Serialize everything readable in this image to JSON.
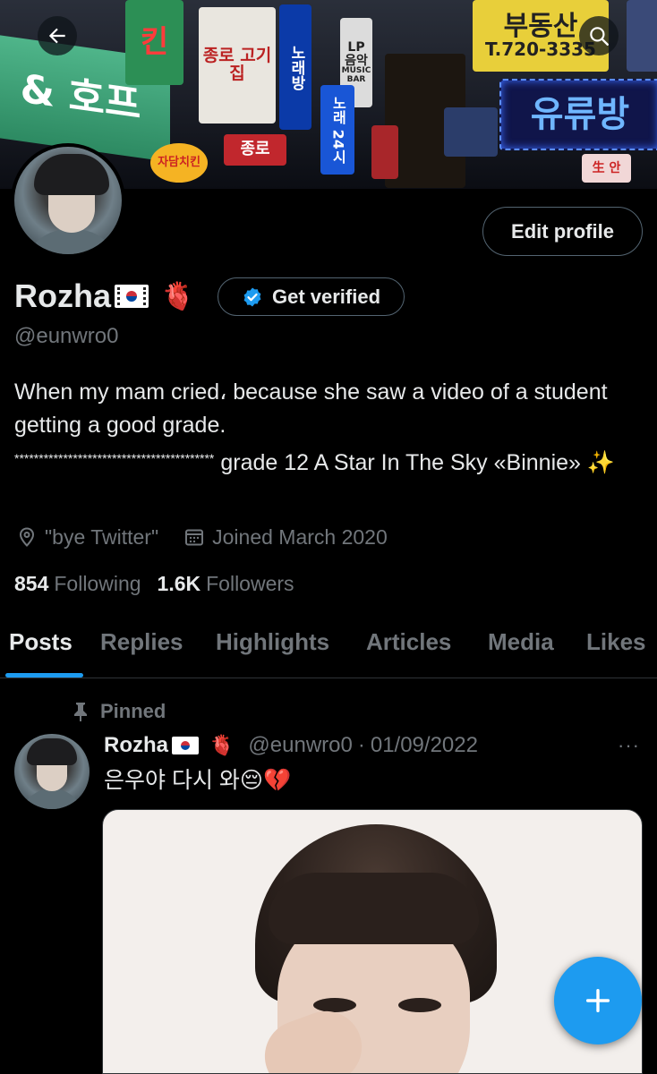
{
  "banner": {
    "signs": {
      "hof": "& 호프",
      "chicken": "킨",
      "meat": "종로 고기집",
      "vertical_blue": "노래방",
      "lp": "LP 음악",
      "music_bar": "MUSIC BAR",
      "vertical_blue2": "노래 24시",
      "jongno": "종로",
      "chicken_round": "자담치킨",
      "realestate": "부동산",
      "phone": "T.720-3335",
      "neon": "유류방",
      "pink": "生 안"
    }
  },
  "header": {
    "back_icon": "arrow-left-icon",
    "search_icon": "search-icon"
  },
  "profile": {
    "edit_label": "Edit profile",
    "display_name": "Rozha",
    "name_emoji": "🫀",
    "verified_label": "Get verified",
    "handle": "@eunwro0",
    "bio_line1": "When my mam cried، because she saw a video of a student getting a good grade.",
    "bio_stars": "*****************************************",
    "bio_line2": " grade 12 A Star In The Sky «Binnie» ✨",
    "location": "\"bye Twitter\"",
    "joined": "Joined March 2020",
    "following_count": "854",
    "following_label": "Following",
    "followers_count": "1.6K",
    "followers_label": "Followers"
  },
  "tabs": [
    {
      "label": "Posts",
      "active": true
    },
    {
      "label": "Replies"
    },
    {
      "label": "Highlights"
    },
    {
      "label": "Articles"
    },
    {
      "label": "Media"
    },
    {
      "label": "Likes"
    }
  ],
  "post": {
    "pinned_label": "Pinned",
    "name": "Rozha",
    "name_emoji": "🫀",
    "handle": "@eunwro0",
    "separator": "·",
    "date": "01/09/2022",
    "more": "···",
    "text": "은우야 다시 와😔💔"
  },
  "colors": {
    "accent": "#1d9bf0",
    "muted": "#71767b",
    "text": "#e7e9ea",
    "background": "#000000"
  }
}
